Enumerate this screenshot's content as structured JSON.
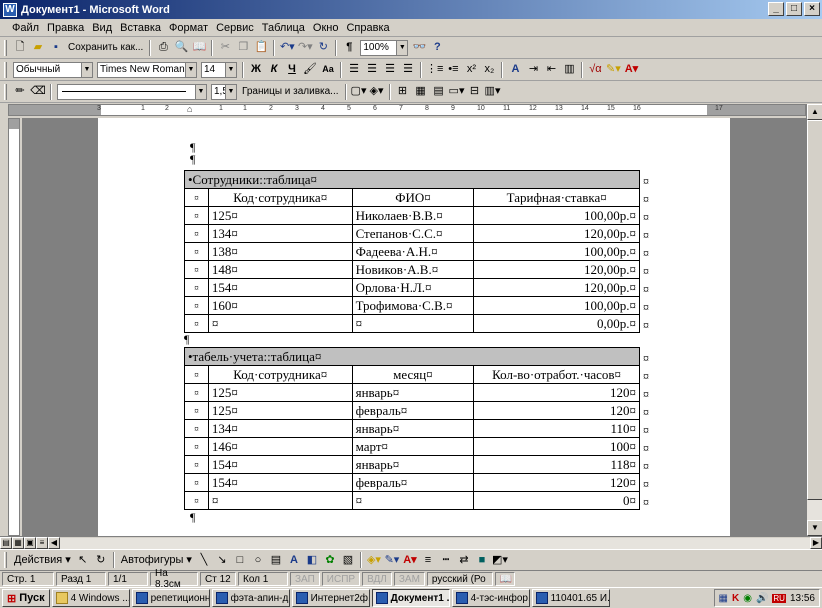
{
  "window": {
    "title": "Документ1 - Microsoft Word",
    "icon": "word-app-icon",
    "buttons": [
      "_",
      "□",
      "×"
    ]
  },
  "menu": [
    "Файл",
    "Правка",
    "Вид",
    "Вставка",
    "Формат",
    "Сервис",
    "Таблица",
    "Окно",
    "Справка"
  ],
  "toolbar1": {
    "save_as": "Сохранить как...",
    "zoom": "100%"
  },
  "toolbar2": {
    "style": "Обычный",
    "font": "Times New Roman",
    "size": "14"
  },
  "toolbar3": {
    "line_width": "1,5",
    "borders_label": "Границы и заливка..."
  },
  "ruler_labels": [
    "3",
    "1",
    "2",
    "1",
    "1",
    "2",
    "3",
    "4",
    "5",
    "6",
    "7",
    "8",
    "9",
    "10",
    "11",
    "12",
    "13",
    "14",
    "15",
    "16",
    "17"
  ],
  "table1": {
    "title": "•Сотрудники::таблица¤",
    "headers": [
      "¤",
      "Код·сотрудника¤",
      "ФИО¤",
      "Тарифная·ставка¤"
    ],
    "rows": [
      [
        "¤",
        "125¤",
        "Николаев·В.В.¤",
        "100,00р.¤"
      ],
      [
        "¤",
        "134¤",
        "Степанов·С.С.¤",
        "120,00р.¤"
      ],
      [
        "¤",
        "138¤",
        "Фадеева·А.Н.¤",
        "100,00р.¤"
      ],
      [
        "¤",
        "148¤",
        "Новиков·А.В.¤",
        "120,00р.¤"
      ],
      [
        "¤",
        "154¤",
        "Орлова·Н.Л.¤",
        "120,00р.¤"
      ],
      [
        "¤",
        "160¤",
        "Трофимова·С.В.¤",
        "100,00р.¤"
      ],
      [
        "¤",
        "¤",
        "¤",
        "0,00р.¤"
      ]
    ]
  },
  "table2": {
    "title": "•табель·учета::таблица¤",
    "headers": [
      "¤",
      "Код·сотрудника¤",
      "месяц¤",
      "Кол-во·отработ.·часов¤"
    ],
    "rows": [
      [
        "¤",
        "125¤",
        "январь¤",
        "120¤"
      ],
      [
        "¤",
        "125¤",
        "февраль¤",
        "120¤"
      ],
      [
        "¤",
        "134¤",
        "январь¤",
        "110¤"
      ],
      [
        "¤",
        "146¤",
        "март¤",
        "100¤"
      ],
      [
        "¤",
        "154¤",
        "январь¤",
        "118¤"
      ],
      [
        "¤",
        "154¤",
        "февраль¤",
        "120¤"
      ],
      [
        "¤",
        "¤",
        "¤",
        "0¤"
      ]
    ]
  },
  "end_marker": "¤",
  "pilcrow": "¶",
  "drawbar": {
    "actions": "Действия",
    "autoshapes": "Автофигуры"
  },
  "status": {
    "page": "Стр. 1",
    "section": "Разд 1",
    "pages": "1/1",
    "at": "На 8,3см",
    "line": "Ст 12",
    "col": "Кол 1",
    "rec": "ЗАП",
    "trk": "ИСПР",
    "ext": "ВДЛ",
    "ovr": "ЗАМ",
    "lang": "русский (Ро"
  },
  "taskbar": {
    "start": "Пуск",
    "items": [
      "4 Windows ...",
      "репетиционн...",
      "фэта-апин-д...",
      "Интернет2ф...",
      "Документ1 ...",
      "4-тэс-инфор...",
      "110401.65 И..."
    ],
    "clock": "13:56"
  }
}
